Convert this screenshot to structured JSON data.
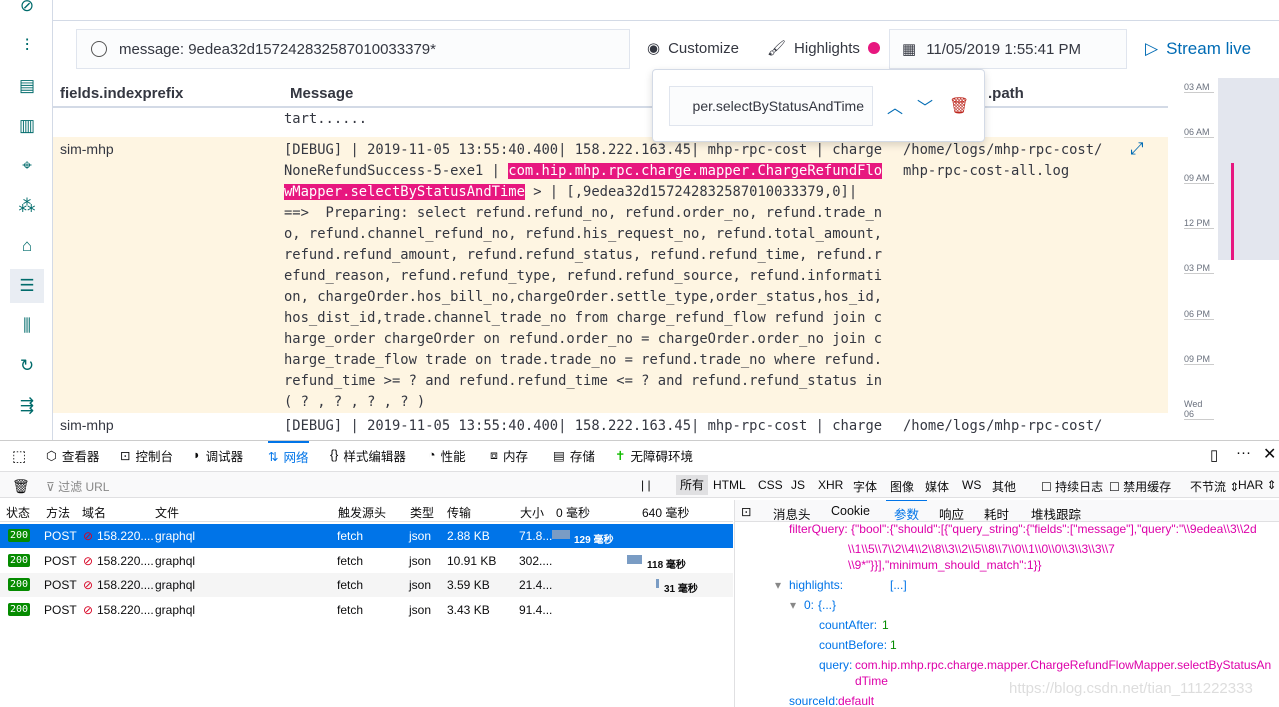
{
  "sidebar": {
    "items": [
      "discover",
      "visualize",
      "dashboard",
      "canvas",
      "maps",
      "ml",
      "infrastructure",
      "logs",
      "apm",
      "uptime",
      "dev-tools",
      "collapse"
    ],
    "active": "logs"
  },
  "toolbar": {
    "search_query": "message: 9edea32d157242832587010033379*",
    "customize": "Customize",
    "highlights": "Highlights",
    "date": "11/05/2019 1:55:41 PM",
    "stream_live": "Stream live"
  },
  "highlight_popover": {
    "value": "com.hip.mhp.rpc.charge.mapper.ChargeRefundFlowMapper.selectByStatusAndTime",
    "visible_value": "per.selectByStatusAndTime"
  },
  "table": {
    "headers": {
      "indexprefix": "fields.indexprefix",
      "message": "Message",
      "path": ".path"
    },
    "rows": [
      {
        "prefix": "",
        "message_lines": [
          [
            {
              "t": "tart......"
            }
          ]
        ],
        "path": ""
      },
      {
        "prefix": "sim-mhp",
        "message_lines": [
          [
            {
              "t": "[DEBUG] | 2019-11-05 13:55:40.400| 158.222.163.45| mhp-rpc-cost | charge"
            }
          ],
          [
            {
              "t": "NoneRefundSuccess-5-exe1 | "
            },
            {
              "t": "com.hip.mhp.rpc.charge.mapper.ChargeRefundFlo",
              "h": true
            }
          ],
          [
            {
              "t": "wMapper.selectByStatusAndTime",
              "h": true
            },
            {
              "t": " > | [,9edea32d157242832587010033379,0]|"
            }
          ],
          [
            {
              "t": "==>  Preparing: select refund.refund_no, refund.order_no, refund.trade_n"
            }
          ],
          [
            {
              "t": "o, refund.channel_refund_no, refund.his_request_no, refund.total_amount,"
            }
          ],
          [
            {
              "t": "refund.refund_amount, refund.refund_status, refund.refund_time, refund.r"
            }
          ],
          [
            {
              "t": "efund_reason, refund.refund_type, refund.refund_source, refund.informati"
            }
          ],
          [
            {
              "t": "on, chargeOrder.hos_bill_no,chargeOrder.settle_type,order_status,hos_id,"
            }
          ],
          [
            {
              "t": "hos_dist_id,trade.channel_trade_no from charge_refund_flow refund join c"
            }
          ],
          [
            {
              "t": "harge_order chargeOrder on refund.order_no = chargeOrder.order_no join c"
            }
          ],
          [
            {
              "t": "harge_trade_flow trade on trade.trade_no = refund.trade_no where refund."
            }
          ],
          [
            {
              "t": "refund_time >= ? and refund.refund_time <= ? and refund.refund_status in"
            }
          ],
          [
            {
              "t": "( ? , ? , ? , ? )"
            }
          ]
        ],
        "path": "/home/logs/mhp-rpc-cost/\nmhp-rpc-cost-all.log"
      },
      {
        "prefix": "sim-mhp",
        "message_lines": [
          [
            {
              "t": "[DEBUG] | 2019-11-05 13:55:40.400| 158.222.163.45| mhp-rpc-cost | charge"
            }
          ]
        ],
        "path": "/home/logs/mhp-rpc-cost/"
      }
    ]
  },
  "timeline": {
    "labels": [
      "03 AM",
      "06 AM",
      "09 AM",
      "12 PM",
      "03 PM",
      "06 PM",
      "09 PM",
      "Wed 06"
    ],
    "accent": "#e7177f"
  },
  "devtools": {
    "tabs": [
      "查看器",
      "控制台",
      "调试器",
      "网络",
      "样式编辑器",
      "性能",
      "内存",
      "存储",
      "无障碍环境"
    ],
    "active_tab": "网络",
    "filter_placeholder": "过滤 URL",
    "type_filters": [
      "所有",
      "HTML",
      "CSS",
      "JS",
      "XHR",
      "字体",
      "图像",
      "媒体",
      "WS",
      "其他"
    ],
    "persist_log": "持续日志",
    "disable_cache": "禁用缓存",
    "throttle": "不节流 ⇕",
    "har": "HAR ⇕",
    "columns": [
      "状态",
      "方法",
      "域名",
      "文件",
      "触发源头",
      "类型",
      "传输",
      "大小",
      "0 毫秒",
      "640 毫秒"
    ],
    "requests": [
      {
        "status": "200",
        "method": "POST",
        "domain": "158.220....",
        "file": "graphql",
        "cause": "fetch",
        "type": "json",
        "transferred": "2.88 KB",
        "size": "71.8...",
        "timing": "129 毫秒",
        "selected": true
      },
      {
        "status": "200",
        "method": "POST",
        "domain": "158.220....",
        "file": "graphql",
        "cause": "fetch",
        "type": "json",
        "transferred": "10.91 KB",
        "size": "302....",
        "timing": "118 毫秒"
      },
      {
        "status": "200",
        "method": "POST",
        "domain": "158.220....",
        "file": "graphql",
        "cause": "fetch",
        "type": "json",
        "transferred": "3.59 KB",
        "size": "21.4...",
        "timing": "31 毫秒"
      },
      {
        "status": "200",
        "method": "POST",
        "domain": "158.220....",
        "file": "graphql",
        "cause": "fetch",
        "type": "json",
        "transferred": "3.43 KB",
        "size": "91.4...",
        "timing": ""
      }
    ],
    "detail_tabs": [
      "消息头",
      "Cookie",
      "参数",
      "响应",
      "耗时",
      "堆栈跟踪"
    ],
    "active_detail_tab": "参数",
    "params": {
      "filter_line1": "filterQuery: {\"bool\":{\"should\":[{\"query_string\":{\"fields\":[\"message\"],\"query\":\"\\\\9edea\\\\3\\\\2d",
      "filter_line2": "\\\\1\\\\5\\\\7\\\\2\\\\4\\\\2\\\\8\\\\3\\\\2\\\\5\\\\8\\\\7\\\\0\\\\1\\\\0\\\\0\\\\3\\\\3\\\\3\\\\7",
      "filter_line3": "\\\\9*\"}}],\"minimum_should_match\":1}}",
      "highlights_key": "highlights:",
      "highlights_val": "[...]",
      "idx_key": "0:",
      "idx_val": "{...}",
      "countAfter_key": "countAfter:",
      "countAfter": "1",
      "countBefore_key": "countBefore:",
      "countBefore": "1",
      "query_key": "query:",
      "query_line1": "com.hip.mhp.rpc.charge.mapper.ChargeRefundFlowMapper.selectByStatusAn",
      "query_line2": "dTime",
      "sourceId_key": "sourceId:",
      "sourceId": "default"
    }
  },
  "watermark": "https://blog.csdn.net/tian_111222333"
}
